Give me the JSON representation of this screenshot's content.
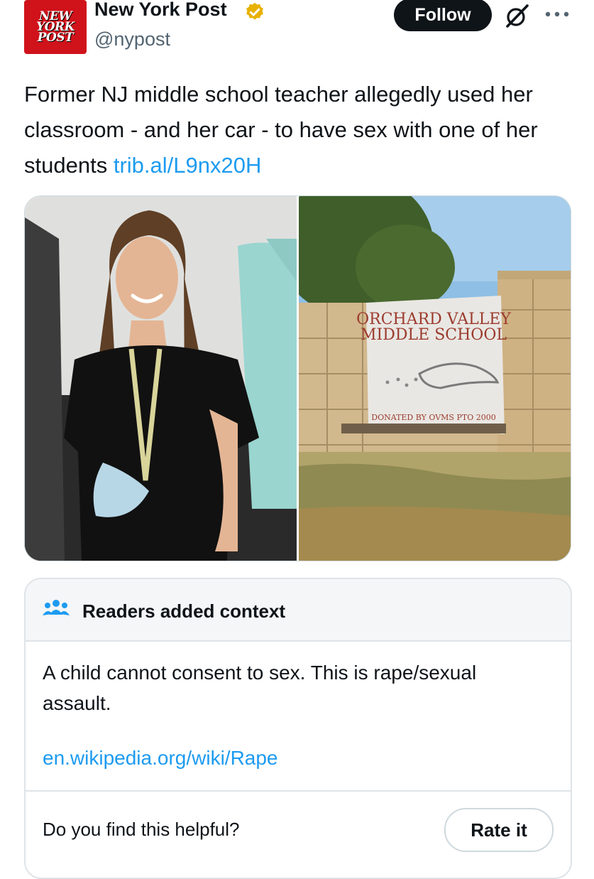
{
  "header": {
    "avatar_lines": [
      "NEW",
      "YORK",
      "POST"
    ],
    "display_name": "New York Post",
    "handle": "@nypost",
    "follow_label": "Follow",
    "icons": [
      "verified-badge-icon",
      "grok-icon",
      "more-icon"
    ],
    "colors": {
      "avatar_bg": "#d0121b",
      "verified": "#e8b100",
      "follow_bg": "#0f1419"
    }
  },
  "tweet": {
    "text": "Former NJ middle school teacher allegedly used her classroom - and her car - to have sex with one of her students",
    "link": "trib.al/L9nx20H",
    "link_color": "#1d9bf0"
  },
  "media": {
    "sign_lines": [
      "ORCHARD VALLEY",
      "MIDDLE SCHOOL"
    ],
    "sign_plaque": "DONATED BY OVMS PTO 2000"
  },
  "note": {
    "title": "Readers added context",
    "body": "A child cannot consent to sex. This is rape/sexual assault.",
    "link": "en.wikipedia.org/wiki/Rape",
    "question": "Do you find this helpful?",
    "rate_label": "Rate it",
    "icon": "people-icon"
  }
}
